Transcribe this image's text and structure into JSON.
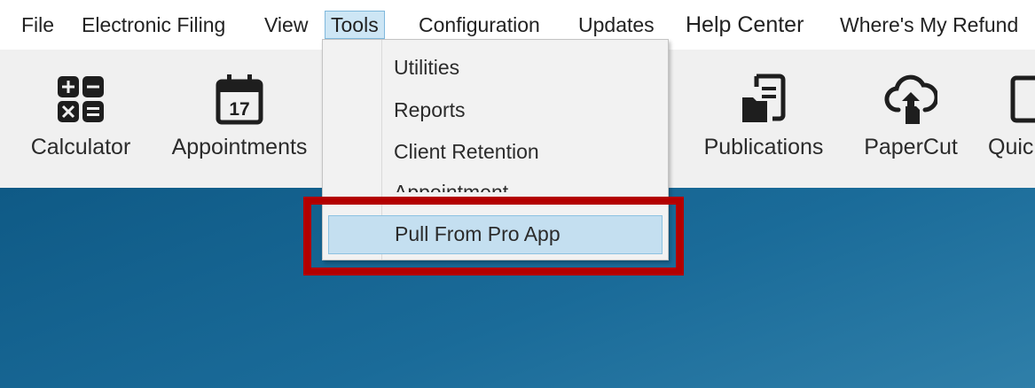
{
  "menubar": {
    "items": [
      {
        "label": "File"
      },
      {
        "label": "Electronic Filing"
      },
      {
        "label": "View"
      },
      {
        "label": "Tools"
      },
      {
        "label": "Configuration"
      },
      {
        "label": "Updates"
      },
      {
        "label": "Help Center"
      },
      {
        "label": "Where's My Refund"
      }
    ],
    "active": "Tools"
  },
  "toolbar": {
    "calculator": {
      "label": "Calculator",
      "icon": "calculator-icon"
    },
    "appointments": {
      "label": "Appointments",
      "icon": "calendar-icon",
      "day": "17"
    },
    "publications": {
      "label": "Publications",
      "icon": "publications-icon"
    },
    "papercut": {
      "label": "PaperCut",
      "icon": "cloud-upload-icon"
    },
    "quick": {
      "label": "Quic",
      "icon": "document-icon"
    }
  },
  "tools_menu": {
    "items": [
      {
        "label": "Utilities"
      },
      {
        "label": "Reports"
      },
      {
        "label": "Client Retention"
      },
      {
        "label": "Appointment"
      },
      {
        "label": "Pull From Pro App"
      }
    ],
    "selected": "Pull From Pro App"
  },
  "colors": {
    "highlight": "#b30000",
    "content_background": "#1a6b99",
    "menu_selected": "#c4dff0"
  }
}
